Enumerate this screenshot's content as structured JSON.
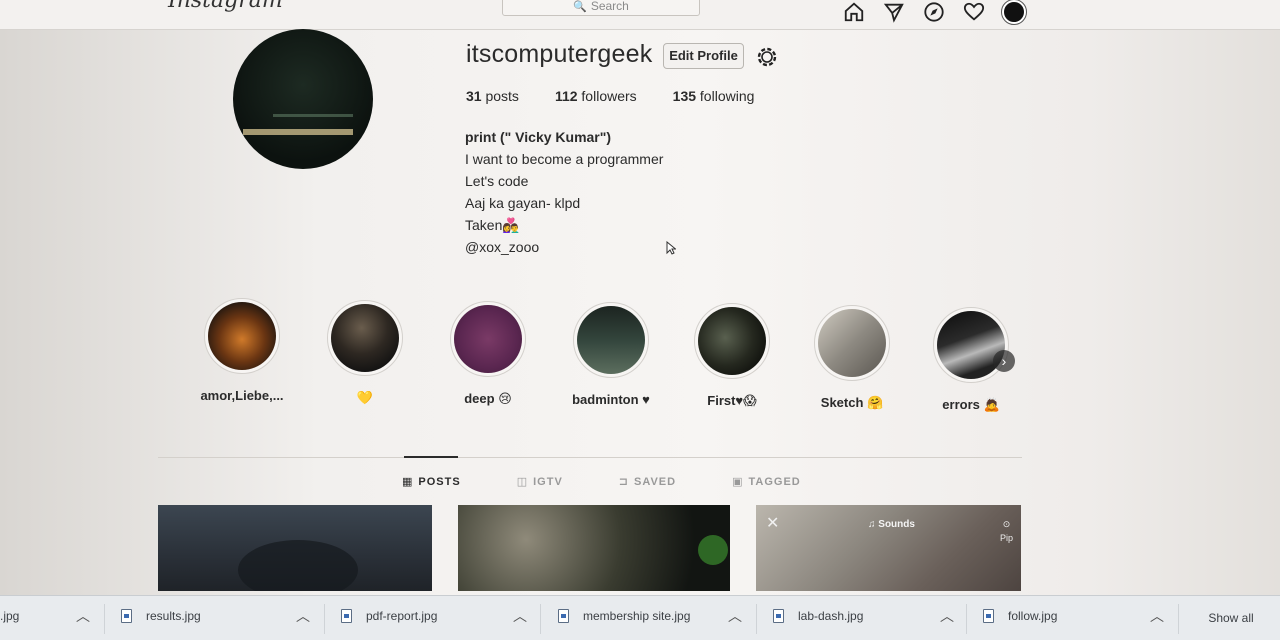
{
  "nav": {
    "logo": "Instagram",
    "search_placeholder": "Search",
    "icons": [
      "home-icon",
      "direct-icon",
      "explore-icon",
      "activity-heart-icon",
      "profile-avatar"
    ]
  },
  "profile": {
    "username": "itscomputergeek",
    "edit_label": "Edit Profile",
    "stats": {
      "posts_count": "31",
      "posts_label": " posts",
      "followers_count": "112",
      "followers_label": " followers",
      "following_count": "135",
      "following_label": " following"
    },
    "bio": {
      "name": "print (\" Vicky Kumar\")",
      "lines": [
        "I want to become a programmer",
        "Let's code",
        "Aaj ka gayan- klpd",
        "Taken👩‍❤️‍👨",
        "@xox_zooo"
      ]
    }
  },
  "highlights": [
    {
      "label": "amor,Liebe,..."
    },
    {
      "label": "💛"
    },
    {
      "label": "deep 😢"
    },
    {
      "label": "badminton ♥"
    },
    {
      "label": "First♥😱"
    },
    {
      "label": "Sketch 🤗"
    },
    {
      "label": "errors 🙇"
    }
  ],
  "tabs": [
    {
      "label": "POSTS",
      "active": true
    },
    {
      "label": "IGTV",
      "active": false
    },
    {
      "label": "SAVED",
      "active": false
    },
    {
      "label": "TAGGED",
      "active": false
    }
  ],
  "posts": {
    "p3_sounds": "♫ Sounds",
    "p3_side": "Pip"
  },
  "downloads": {
    "items": [
      ".jpg",
      "results.jpg",
      "pdf-report.jpg",
      "membership site.jpg",
      "lab-dash.jpg",
      "follow.jpg"
    ],
    "show_all": "Show all"
  }
}
